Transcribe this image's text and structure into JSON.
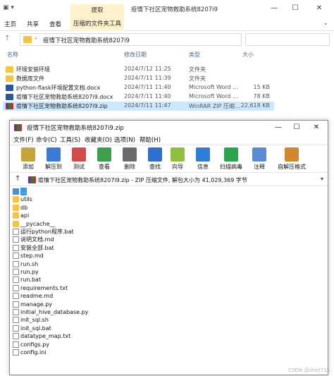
{
  "explorer": {
    "title": "疫情下社区宠物救助系统8207i9",
    "context_tab_top": "提取",
    "tabs": [
      "主页",
      "共享",
      "查看"
    ],
    "context_tab": "压缩的文件夹工具",
    "address_path": "疫情下社区宠物救助系统8207i9",
    "columns": {
      "name": "名称",
      "date": "修改日期",
      "type": "类型",
      "size": "大小"
    },
    "rows": [
      {
        "icon": "folder",
        "name": "环境安装环境",
        "date": "2024/7/12 11:25",
        "type": "文件夹",
        "size": ""
      },
      {
        "icon": "folder",
        "name": "数据库文件",
        "date": "2024/7/11 11:39",
        "type": "文件夹",
        "size": ""
      },
      {
        "icon": "docx",
        "name": "python-flask环境配置文档.docx",
        "date": "2024/7/11 11:40",
        "type": "Microsoft Word ...",
        "size": "15 KB"
      },
      {
        "icon": "docx",
        "name": "疫情下社区宠物救助系统8207i9.docx",
        "date": "2024/7/11 11:40",
        "type": "Microsoft Word ...",
        "size": "78 KB"
      },
      {
        "icon": "zip",
        "name": "疫情下社区宠物救助系统8207i9.zip",
        "date": "2024/7/11 11:47",
        "type": "WinRAR ZIP 压缩...",
        "size": "22,618 KB"
      }
    ]
  },
  "winrar": {
    "title": "疫情下社区宠物救助系统8207i9.zip",
    "menu": [
      "文件(F)",
      "命令(C)",
      "工具(S)",
      "收藏夹(O)",
      "选项(N)",
      "帮助(H)"
    ],
    "tools": [
      {
        "label": "添加",
        "icon": "add-icon",
        "color": "#c8a23a"
      },
      {
        "label": "解压到",
        "icon": "extract-to-icon",
        "color": "#3a7bd5"
      },
      {
        "label": "测试",
        "icon": "test-icon",
        "color": "#d24b4b"
      },
      {
        "label": "查看",
        "icon": "view-icon",
        "color": "#3aa04a"
      },
      {
        "label": "删除",
        "icon": "delete-icon",
        "color": "#6b6b6b"
      },
      {
        "label": "查找",
        "icon": "find-icon",
        "color": "#2f6fcf"
      },
      {
        "label": "向导",
        "icon": "wizard-icon",
        "color": "#8fbf3f"
      },
      {
        "label": "信息",
        "icon": "info-icon",
        "color": "#2d7fd6"
      },
      {
        "label": "扫描病毒",
        "icon": "virus-scan-icon",
        "color": "#2ca44b"
      },
      {
        "label": "注释",
        "icon": "comment-icon",
        "color": "#5a8bd6"
      },
      {
        "label": "自解压格式",
        "icon": "sfx-icon",
        "color": "#d2872d"
      }
    ],
    "path_text": "疫情下社区宠物救助系统8207i9.zip - ZIP 压缩文件, 解包大小为 41,029,369 字节",
    "files": [
      {
        "icon": "up",
        "name": ".."
      },
      {
        "icon": "folder",
        "name": "utils"
      },
      {
        "icon": "folder",
        "name": "db"
      },
      {
        "icon": "folder",
        "name": "api"
      },
      {
        "icon": "folder",
        "name": "__pycache__"
      },
      {
        "icon": "file",
        "name": "运行python程序.bat"
      },
      {
        "icon": "file",
        "name": "说明文档.md"
      },
      {
        "icon": "file",
        "name": "安装全部.bat"
      },
      {
        "icon": "file",
        "name": "step.md"
      },
      {
        "icon": "file",
        "name": "run.sh"
      },
      {
        "icon": "file",
        "name": "run.py"
      },
      {
        "icon": "file",
        "name": "run.bat"
      },
      {
        "icon": "file",
        "name": "requirements.txt"
      },
      {
        "icon": "file",
        "name": "readme.md"
      },
      {
        "icon": "file",
        "name": "manage.py"
      },
      {
        "icon": "file",
        "name": "initial_hive_database.py"
      },
      {
        "icon": "file",
        "name": "init_sql.sh"
      },
      {
        "icon": "file",
        "name": "init_sql.bat"
      },
      {
        "icon": "file",
        "name": "datatype_map.txt"
      },
      {
        "icon": "file",
        "name": "configs.py"
      },
      {
        "icon": "file",
        "name": "config.ini"
      }
    ]
  },
  "watermark": "CSDN @shejl715"
}
